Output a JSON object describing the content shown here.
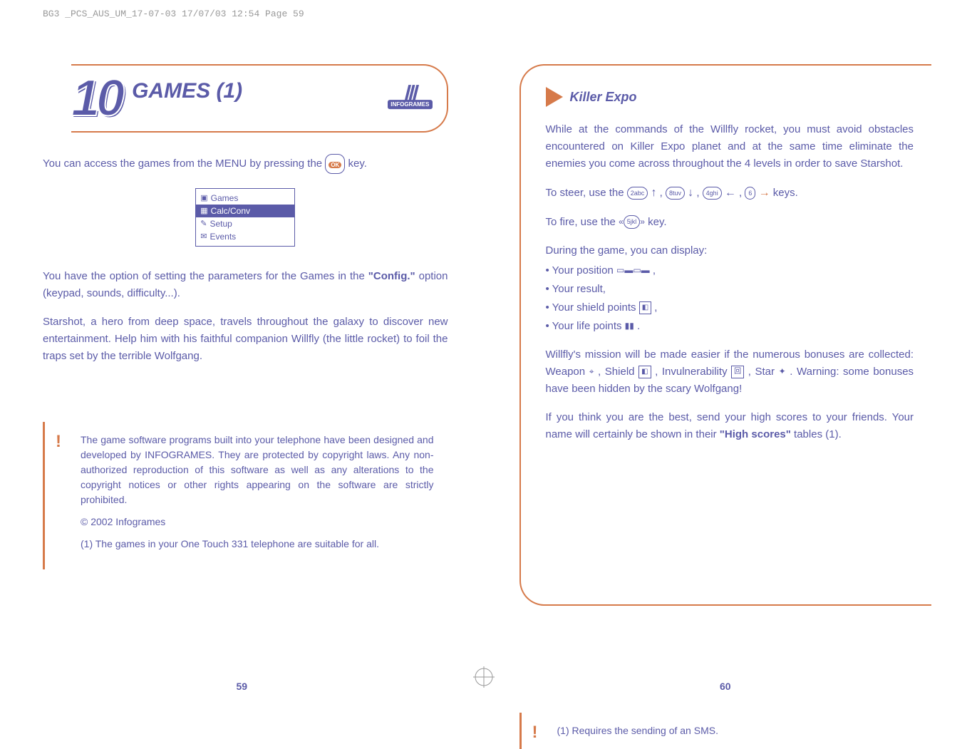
{
  "header": "BG3 _PCS_AUS_UM_17-07-03  17/07/03  12:54  Page 59",
  "left": {
    "chapterNum": "10",
    "chapterTitle": "GAMES (1)",
    "logoText": "INFOGRAMES",
    "intro_a": "You can access the games from the MENU by pressing the ",
    "intro_b": " key.",
    "okLabel": "OK",
    "screen": {
      "r1": "Games",
      "r2": "Calc/Conv",
      "r3": "Setup",
      "r4": "Events"
    },
    "para1a": "You have the option of setting the parameters for the Games in the ",
    "para1b": "\"Config.\"",
    "para1c": " option (keypad, sounds, difficulty...).",
    "para2": "Starshot, a hero from deep space, travels throughout the galaxy to discover new entertainment.  Help him with his faithful companion Willfly (the little rocket) to foil the traps set by the terrible Wolfgang.",
    "note1": "The game software programs built into your telephone have been designed and developed by INFOGRAMES. They are protected by copyright laws. Any non-authorized reproduction of this software as well as any alterations to the copyright notices or other rights appearing on the software are strictly prohibited.",
    "note2": "© 2002 Infogrames",
    "note3": "(1) The games in your One Touch 331 telephone are suitable for all.",
    "pageNum": "59"
  },
  "right": {
    "sectionTitle": "Killer Expo",
    "para1": "While at the commands of the Willfly rocket, you must avoid obstacles encountered on Killer Expo planet and at the same time eliminate the enemies you come across throughout the 4 levels in order to save Starshot.",
    "steer_a": "To steer, use the ",
    "steer_keys": "keys.",
    "fire_a": "To fire, use the ",
    "fire_b": " key.",
    "during": "During the game, you can display:",
    "b1": "• Your position ",
    "b2": "• Your result,",
    "b3": "• Your shield points ",
    "b4": "• Your life points ",
    "para2a": "Willfly's mission will be made easier if the numerous bonuses are collected: Weapon ",
    "para2b": " , Shield ",
    "para2c": " , Invulnerability ",
    "para2d": " , Star ",
    "para2e": " . Warning: some bonuses have been hidden by the scary Wolfgang!",
    "para3a": "If you think you are the best, send your high scores to your friends. Your name will certainly be shown in their ",
    "para3b": "\"High scores\"",
    "para3c": " tables (1).",
    "footnote": "(1)  Requires the sending of an SMS.",
    "pageNum": "60",
    "k2": "2abc",
    "k8": "8tuv",
    "k4": "4ghi",
    "k6": "6",
    "k5": "5jkl"
  }
}
